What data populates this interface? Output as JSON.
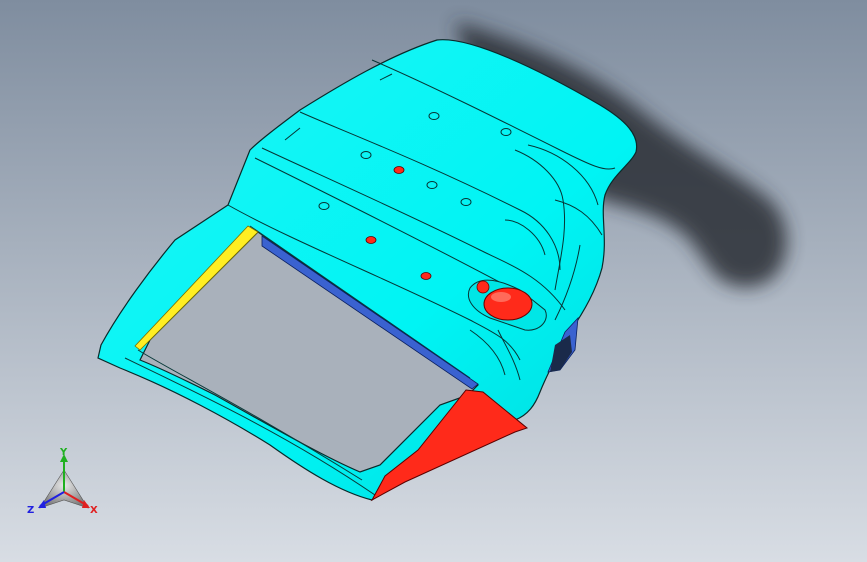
{
  "viewport": {
    "background_top": "#7f8d9f",
    "background_bottom": "#d8dde4",
    "part_color": "#00ffff",
    "part_edge": "#0a2a2a",
    "red_face": "#ff2a1a",
    "yellow_strip": "#ffee22",
    "blue_edge": "#3a62d0",
    "shadow": "#2c2f34"
  },
  "triad": {
    "x_label": "X",
    "y_label": "Y",
    "z_label": "Z",
    "x_color": "#e02020",
    "y_color": "#20b020",
    "z_color": "#2020e0",
    "icon": "coordinate-triad-icon"
  }
}
